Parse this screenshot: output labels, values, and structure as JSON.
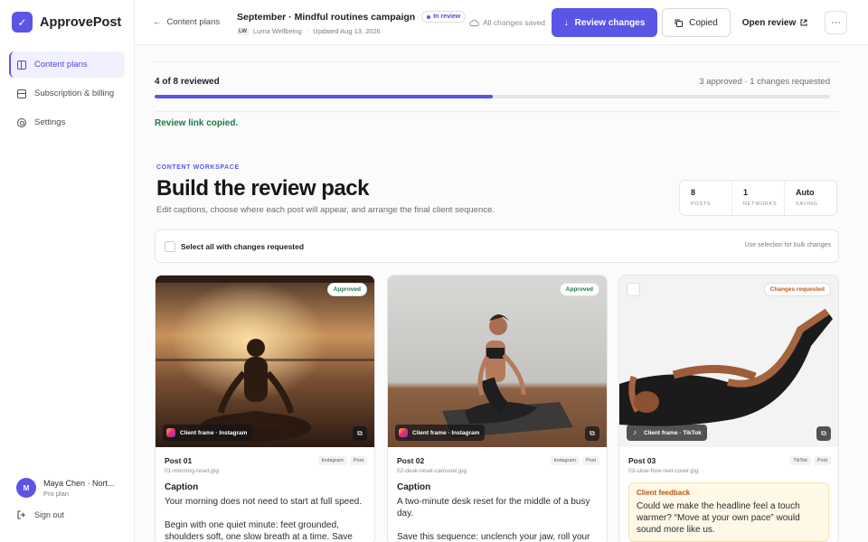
{
  "app": {
    "name": "ApprovePost"
  },
  "sidebar": {
    "items": [
      {
        "label": "Content plans",
        "icon": "grid-icon",
        "active": true
      },
      {
        "label": "Subscription & billing",
        "icon": "card-icon",
        "active": false
      },
      {
        "label": "Settings",
        "icon": "gear-icon",
        "active": false
      }
    ],
    "user": {
      "initial": "M",
      "name": "Maya Chen · Nort...",
      "plan": "Pro plan"
    },
    "signout": "Sign out"
  },
  "topbar": {
    "back_label": "Content plans",
    "campaign_title": "September · Mindful routines campaign",
    "status": "In review",
    "client_initials": "LW",
    "client": "Luma Wellbeing",
    "updated": "Updated Aug 13, 2026",
    "saved": "All changes saved",
    "review_button": "Review changes",
    "copied_button": "Copied",
    "open_button": "Open review",
    "more": "···"
  },
  "progress": {
    "label": "4 of 8 reviewed",
    "summary": "3 approved · 1 changes requested",
    "value": 0.5
  },
  "copied_message": "Review link copied.",
  "workspace": {
    "kicker": "CONTENT WORKSPACE",
    "title": "Build the review pack",
    "subtitle": "Edit captions, choose where each post will appear, and arrange the final client sequence."
  },
  "stats": [
    {
      "value": "8",
      "label": "POSTS"
    },
    {
      "value": "1",
      "label": "NETWORKS"
    },
    {
      "value": "Auto",
      "label": "SAVING"
    }
  ],
  "selection": {
    "label": "Select all with changes requested",
    "hint": "Use selection for bulk changes"
  },
  "cards": [
    {
      "status": "Approved",
      "frame": "Client frame · Instagram",
      "title": "Post 01",
      "file": "01-morning-reset.jpg",
      "network": "Instagram",
      "format": "Post",
      "caption_label": "Caption",
      "caption": "Your morning does not need to start at full speed.",
      "caption_more": "Begin with one quiet minute: feet grounded, shoulders soft, one slow breath at a time. Save this"
    },
    {
      "status": "Approved",
      "frame": "Client frame · Instagram",
      "title": "Post 02",
      "file": "02-desk-reset-carousel.jpg",
      "network": "Instagram",
      "format": "Post",
      "caption_label": "Caption",
      "caption": "A two-minute desk reset for the middle of a busy day.",
      "caption_more": "Save this sequence: unclench your jaw, roll your"
    },
    {
      "status": "Changes requested",
      "frame": "Client frame · TikTok",
      "title": "Post 03",
      "file": "03-slow-flow-reel-cover.jpg",
      "network": "TikTok",
      "format": "Post",
      "feedback_label": "Client feedback",
      "feedback": "Could we make the headline feel a touch warmer? “Move at your own pace” would sound more like us."
    }
  ]
}
